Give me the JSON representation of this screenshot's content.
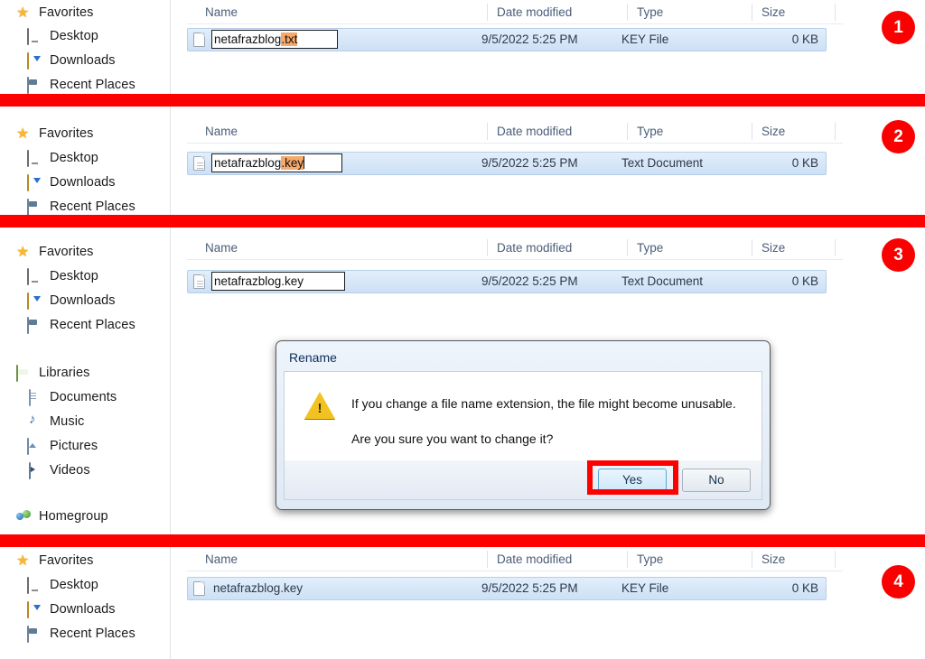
{
  "meta": {
    "app": "Windows Explorer",
    "accent_red": "#fe0000",
    "selection_highlight": "#f6a96a",
    "row_select_blue": "#cde0f5"
  },
  "sidebar": {
    "favorites_group": [
      {
        "label": "Favorites",
        "icon": "star-icon",
        "level": 0
      },
      {
        "label": "Desktop",
        "icon": "desktop-icon",
        "level": 1
      },
      {
        "label": "Downloads",
        "icon": "downloads-icon",
        "level": 1
      },
      {
        "label": "Recent Places",
        "icon": "recent-places-icon",
        "level": 1
      }
    ],
    "libraries_group": [
      {
        "label": "Libraries",
        "icon": "libraries-icon",
        "level": 0
      },
      {
        "label": "Documents",
        "icon": "documents-icon",
        "level": 1
      },
      {
        "label": "Music",
        "icon": "music-icon",
        "level": 1
      },
      {
        "label": "Pictures",
        "icon": "pictures-icon",
        "level": 1
      },
      {
        "label": "Videos",
        "icon": "videos-icon",
        "level": 1
      }
    ],
    "homegroup_group": [
      {
        "label": "Homegroup",
        "icon": "homegroup-icon",
        "level": 0
      }
    ]
  },
  "columns": {
    "name": "Name",
    "date_modified": "Date modified",
    "type": "Type",
    "size": "Size"
  },
  "panels": [
    {
      "badge": "1",
      "mode": "editing",
      "file": {
        "name_prefix": "netafrazblog",
        "name_selected": ".txt",
        "full_name": "netafrazblog.txt",
        "date_modified": "9/5/2022 5:25 PM",
        "type": "KEY File",
        "size": "0 KB"
      }
    },
    {
      "badge": "2",
      "mode": "editing",
      "file": {
        "name_prefix": "netafrazblog",
        "name_selected": ".key",
        "full_name": "netafrazblog.key",
        "date_modified": "9/5/2022 5:25 PM",
        "type": "Text Document",
        "size": "0 KB"
      }
    },
    {
      "badge": "3",
      "mode": "editing-committed",
      "file": {
        "name_prefix": "netafrazblog.key",
        "name_selected": "",
        "full_name": "netafrazblog.key",
        "date_modified": "9/5/2022 5:25 PM",
        "type": "Text Document",
        "size": "0 KB"
      }
    },
    {
      "badge": "4",
      "mode": "normal",
      "file": {
        "name_prefix": "netafrazblog.key",
        "name_selected": "",
        "full_name": "netafrazblog.key",
        "date_modified": "9/5/2022 5:25 PM",
        "type": "KEY File",
        "size": "0 KB"
      }
    }
  ],
  "dialog": {
    "title": "Rename",
    "line1": "If you change a file name extension, the file might become unusable.",
    "line2": "Are you sure you want to change it?",
    "yes_label": "Yes",
    "no_label": "No",
    "warning_icon": "warning-triangle-icon",
    "highlighted_button": "Yes"
  }
}
